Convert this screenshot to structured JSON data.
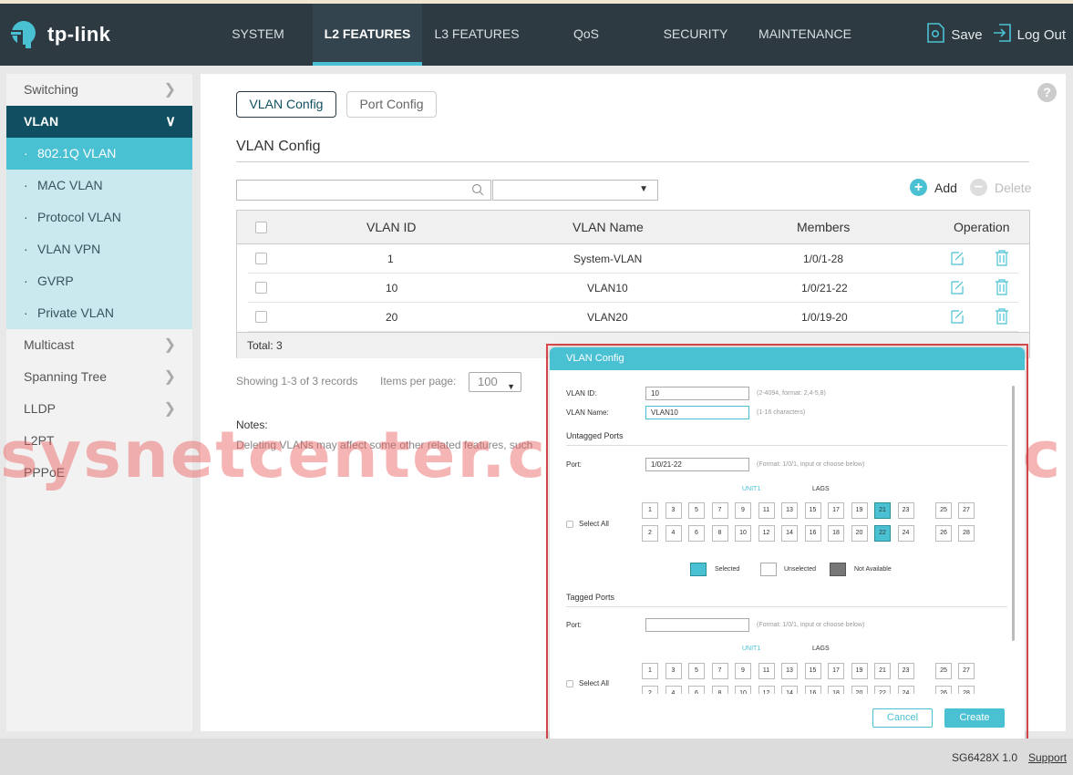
{
  "header": {
    "brand": "tp-link",
    "nav": [
      {
        "label": "SYSTEM",
        "active": false
      },
      {
        "label": "L2 FEATURES",
        "active": true
      },
      {
        "label": "L3 FEATURES",
        "active": false
      },
      {
        "label": "QoS",
        "active": false
      },
      {
        "label": "SECURITY",
        "active": false
      },
      {
        "label": "MAINTENANCE",
        "active": false
      }
    ],
    "save_label": "Save",
    "logout_label": "Log Out"
  },
  "sidebar": {
    "top": [
      {
        "label": "Switching"
      }
    ],
    "group": {
      "label": "VLAN",
      "items": [
        {
          "label": "802.1Q VLAN",
          "active": true
        },
        {
          "label": "MAC VLAN"
        },
        {
          "label": "Protocol VLAN"
        },
        {
          "label": "VLAN VPN"
        },
        {
          "label": "GVRP"
        },
        {
          "label": "Private VLAN"
        }
      ]
    },
    "rest": [
      {
        "label": "Multicast",
        "chevron": true
      },
      {
        "label": "Spanning Tree",
        "chevron": true
      },
      {
        "label": "LLDP",
        "chevron": true
      },
      {
        "label": "L2PT",
        "chevron": false
      },
      {
        "label": "PPPoE",
        "chevron": false
      }
    ]
  },
  "main": {
    "tabs": {
      "vlan_config": "VLAN Config",
      "port_config": "Port Config"
    },
    "section_title": "VLAN Config",
    "add_label": "Add",
    "delete_label": "Delete",
    "table": {
      "columns": {
        "id": "VLAN ID",
        "name": "VLAN Name",
        "members": "Members",
        "operation": "Operation"
      },
      "rows": [
        {
          "id": "1",
          "name": "System-VLAN",
          "members": "1/0/1-28"
        },
        {
          "id": "10",
          "name": "VLAN10",
          "members": "1/0/21-22"
        },
        {
          "id": "20",
          "name": "VLAN20",
          "members": "1/0/19-20"
        }
      ],
      "total": "Total: 3"
    },
    "showing": "Showing 1-3 of 3 records",
    "items_per_page_label": "Items per page:",
    "items_per_page": "100",
    "notes_title": "Notes:",
    "notes_text": "Deleting VLANs may affect some other related features, such"
  },
  "watermark": {
    "left": "sysnetcenter.com",
    "right": "sysnetc"
  },
  "modal": {
    "title": "VLAN Config",
    "vlan_id_label": "VLAN ID:",
    "vlan_id_value": "10",
    "vlan_id_hint": "(2-4094, format: 2,4-5,8)",
    "vlan_name_label": "VLAN Name:",
    "vlan_name_value": "VLAN10",
    "vlan_name_hint": "(1-16 characters)",
    "untagged_title": "Untagged Ports",
    "tagged_title": "Tagged Ports",
    "port_label": "Port:",
    "untagged_port_value": "1/0/21-22",
    "tagged_port_value": "",
    "port_hint": "(Format: 1/0/1, input or choose below)",
    "unit_label": "UNIT1",
    "lags_label": "LAGS",
    "select_all": "Select All",
    "top_ports": [
      "1",
      "3",
      "5",
      "7",
      "9",
      "11",
      "13",
      "15",
      "17",
      "19",
      "21",
      "23"
    ],
    "bottom_ports": [
      "2",
      "4",
      "6",
      "8",
      "10",
      "12",
      "14",
      "16",
      "18",
      "20",
      "22",
      "24"
    ],
    "top_extra": [
      "25",
      "27"
    ],
    "bottom_extra": [
      "26",
      "28"
    ],
    "selected_ports": [
      "21",
      "22"
    ],
    "legend": {
      "selected": "Selected",
      "unselected": "Unselected",
      "not_available": "Not Available"
    },
    "cancel_label": "Cancel",
    "create_label": "Create"
  },
  "footer": {
    "model": "SG6428X 1.0",
    "support": "Support"
  },
  "colors": {
    "accent": "#4ac1d3",
    "nav_bg": "#2d3a42",
    "group_bg": "#0f4f61",
    "frame": "#d9484d"
  }
}
